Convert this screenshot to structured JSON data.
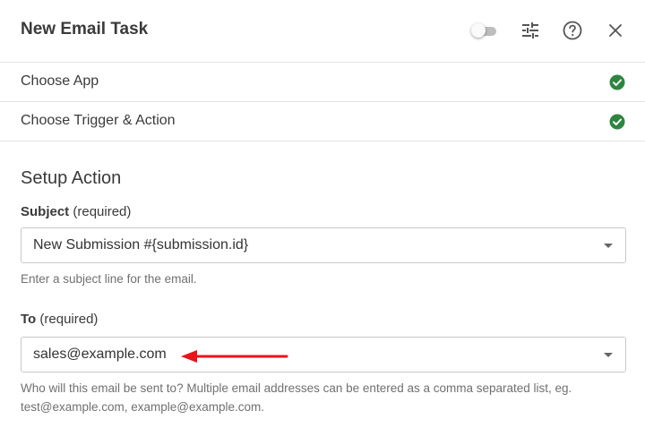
{
  "header": {
    "title": "New Email Task",
    "toggle_state": "off",
    "icons": [
      "toggle-switch",
      "settings-sliders-icon",
      "help-circle-icon",
      "close-icon"
    ]
  },
  "steps": [
    {
      "label": "Choose App",
      "status": "complete"
    },
    {
      "label": "Choose Trigger & Action",
      "status": "complete"
    }
  ],
  "setup": {
    "title": "Setup Action",
    "subject": {
      "label": "Subject",
      "required_text": "(required)",
      "value": "New Submission #{submission.id}",
      "help": "Enter a subject line for the email."
    },
    "to": {
      "label": "To",
      "required_text": "(required)",
      "value": "sales@example.com",
      "help": "Who will this email be sent to? Multiple email addresses can be entered as a comma separated list, eg. test@example.com, example@example.com."
    }
  },
  "colors": {
    "check_green": "#2e8540",
    "annotation_arrow": "#e8131b",
    "border": "#c9c9c9",
    "divider": "#e3e3e3"
  }
}
